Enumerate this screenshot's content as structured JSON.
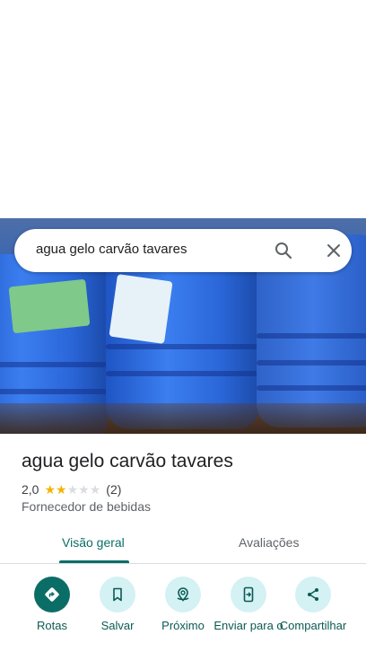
{
  "search": {
    "query": "agua gelo carvão tavares"
  },
  "place": {
    "title": "agua gelo carvão tavares",
    "rating_value": "2,0",
    "rating_stars": 2,
    "rating_max": 5,
    "review_count": "(2)",
    "category": "Fornecedor de bebidas"
  },
  "tabs": [
    {
      "label": "Visão geral",
      "active": true
    },
    {
      "label": "Avaliações",
      "active": false
    }
  ],
  "actions": [
    {
      "label": "Rotas",
      "icon": "directions-icon"
    },
    {
      "label": "Salvar",
      "icon": "bookmark-icon"
    },
    {
      "label": "Próximo",
      "icon": "nearby-icon"
    },
    {
      "label": "Enviar para o",
      "icon": "send-to-phone-icon"
    },
    {
      "label": "Compartilhar",
      "icon": "share-icon"
    }
  ],
  "colors": {
    "accent": "#0b6e66",
    "action_bg": "#d4f1f4",
    "star": "#f4b400"
  }
}
